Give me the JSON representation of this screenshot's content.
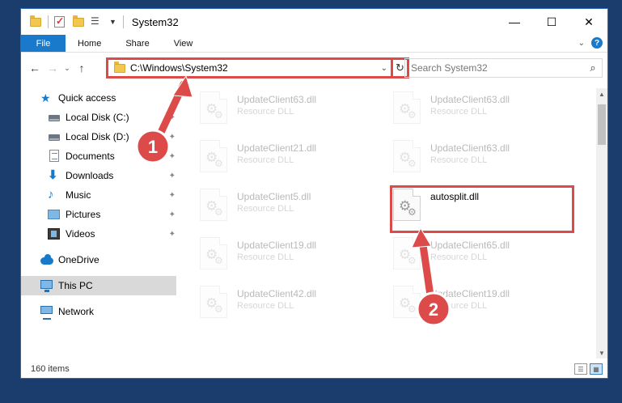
{
  "window": {
    "title": "System32",
    "controls": {
      "minimize": "—",
      "maximize": "☐",
      "close": "✕"
    }
  },
  "ribbon": {
    "tabs": [
      "File",
      "Home",
      "Share",
      "View"
    ],
    "help": "?"
  },
  "address": {
    "path": "C:\\Windows\\System32",
    "search_placeholder": "Search System32"
  },
  "nav": {
    "items": [
      {
        "label": "Quick access",
        "icon": "star-icon",
        "pinned": false
      },
      {
        "label": "Local Disk (C:)",
        "icon": "drive-icon",
        "pinned": true
      },
      {
        "label": "Local Disk (D:)",
        "icon": "drive-icon",
        "pinned": true
      },
      {
        "label": "Documents",
        "icon": "documents-icon",
        "pinned": true
      },
      {
        "label": "Downloads",
        "icon": "download-icon",
        "pinned": true
      },
      {
        "label": "Music",
        "icon": "music-icon",
        "pinned": true
      },
      {
        "label": "Pictures",
        "icon": "pictures-icon",
        "pinned": true
      },
      {
        "label": "Videos",
        "icon": "videos-icon",
        "pinned": true
      },
      {
        "label": "OneDrive",
        "icon": "onedrive-icon",
        "pinned": false
      },
      {
        "label": "This PC",
        "icon": "this-pc-icon",
        "pinned": false,
        "selected": true
      },
      {
        "label": "Network",
        "icon": "network-icon",
        "pinned": false
      }
    ]
  },
  "files": [
    {
      "name": "UpdateClient63.dll",
      "type": "Resource DLL",
      "faded": true
    },
    {
      "name": "UpdateClient63.dll",
      "type": "Resource DLL",
      "faded": true
    },
    {
      "name": "UpdateClient21.dll",
      "type": "Resource DLL",
      "faded": true
    },
    {
      "name": "UpdateClient63.dll",
      "type": "Resource DLL",
      "faded": true
    },
    {
      "name": "UpdateClient5.dll",
      "type": "Resource DLL",
      "faded": true
    },
    {
      "name": "autosplit.dll",
      "type": "",
      "faded": false
    },
    {
      "name": "UpdateClient19.dll",
      "type": "Resource DLL",
      "faded": true
    },
    {
      "name": "UpdateClient65.dll",
      "type": "Resource DLL",
      "faded": true
    },
    {
      "name": "UpdateClient42.dll",
      "type": "Resource DLL",
      "faded": true
    },
    {
      "name": "UpdateClient19.dll",
      "type": "Resource DLL",
      "faded": true
    }
  ],
  "status": {
    "item_count": "160 items"
  },
  "annotations": {
    "step1": "1",
    "step2": "2",
    "color": "#dd4a4a"
  }
}
